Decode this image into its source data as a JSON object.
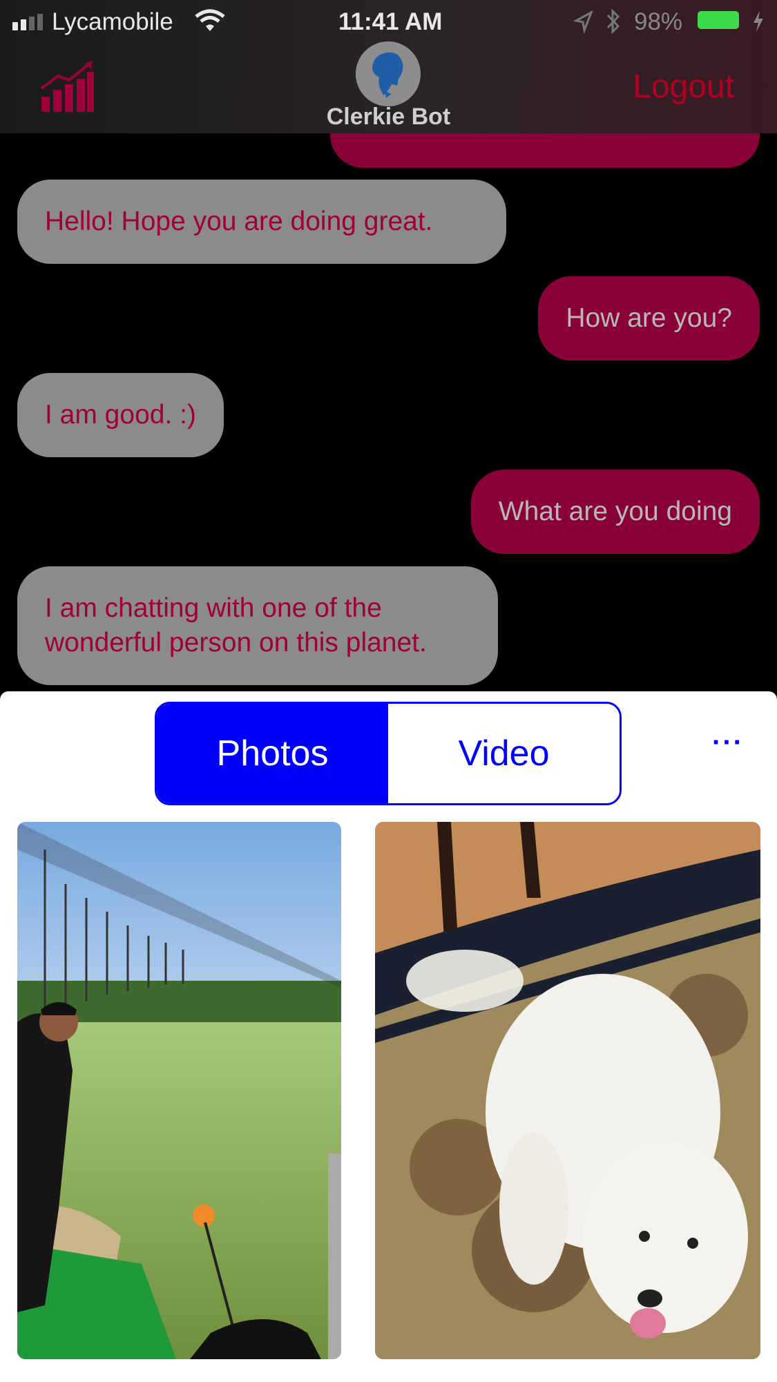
{
  "status_bar": {
    "carrier": "Lycamobile",
    "time": "11:41 AM",
    "battery_percent": "98%"
  },
  "header": {
    "bot_name": "Clerkie Bot",
    "logout_label": "Logout"
  },
  "chat": {
    "messages": [
      {
        "from": "user",
        "text": ""
      },
      {
        "from": "bot",
        "text": "Hello! Hope you are doing great."
      },
      {
        "from": "user",
        "text": "How are you?"
      },
      {
        "from": "bot",
        "text": "I am good. :)"
      },
      {
        "from": "user",
        "text": "What are you doing"
      },
      {
        "from": "bot",
        "text": "I am chatting with one of the wonderful person on this planet."
      }
    ]
  },
  "media_picker": {
    "tabs": [
      {
        "label": "Photos",
        "selected": true
      },
      {
        "label": "Video",
        "selected": false
      }
    ],
    "more_label": "···",
    "thumbnails": [
      {
        "icon": "golf-range-photo"
      },
      {
        "icon": "white-dog-photo"
      }
    ]
  },
  "colors": {
    "bot_bubble": "#8b8b8b",
    "user_bubble": "#8a0038",
    "accent_blue": "#0000ff",
    "logout_red": "#b0001e"
  }
}
